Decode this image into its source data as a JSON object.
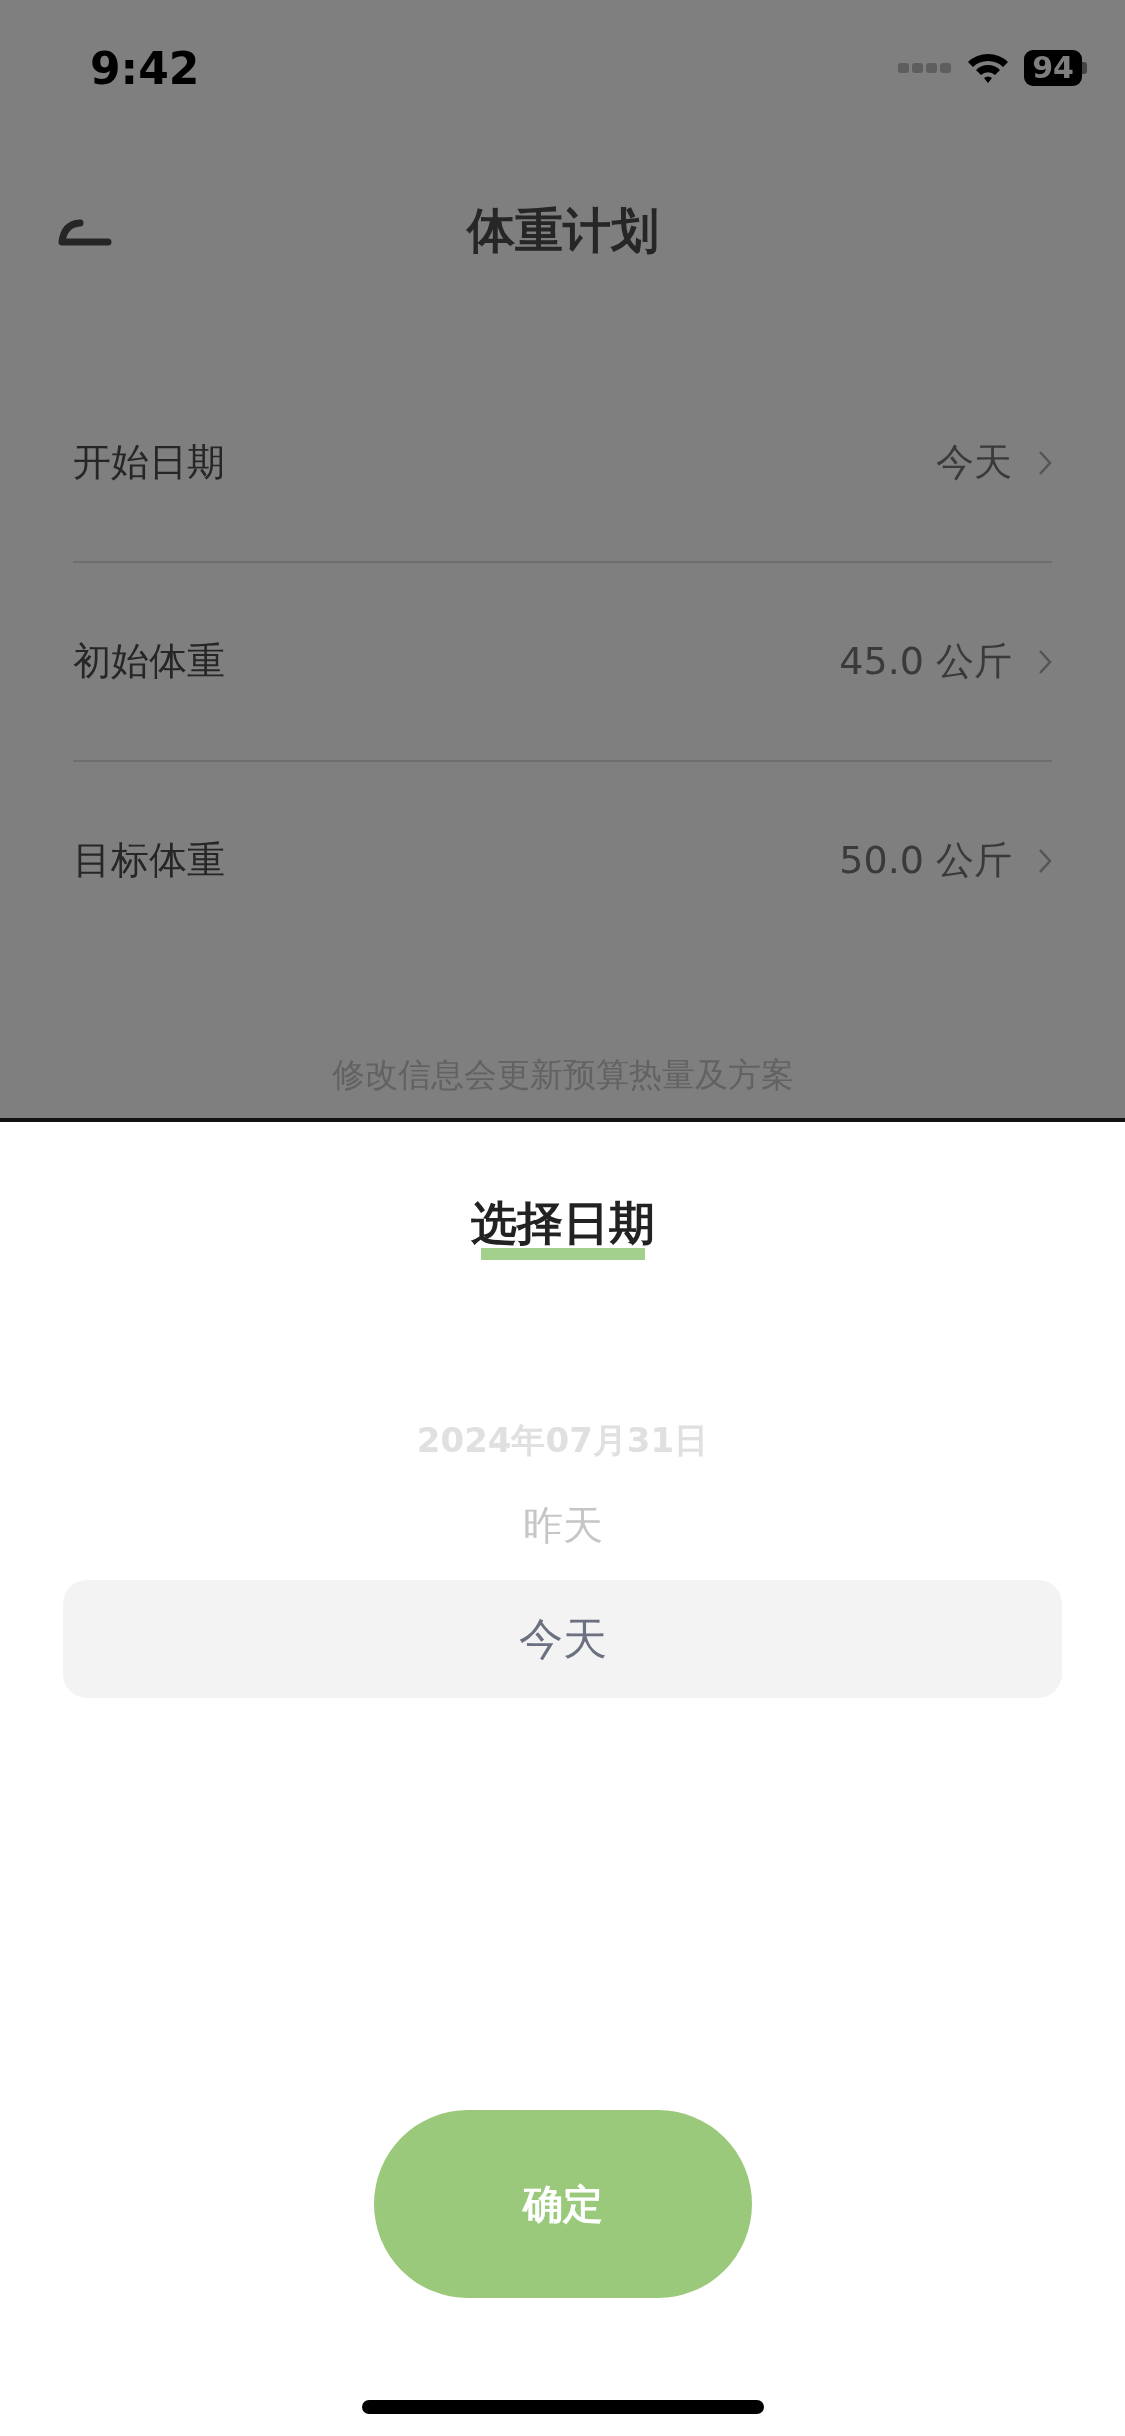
{
  "status_bar": {
    "time": "9:42",
    "battery": "94"
  },
  "nav": {
    "title": "体重计划"
  },
  "rows": [
    {
      "label": "开始日期",
      "value": "今天"
    },
    {
      "label": "初始体重",
      "value": "45.0 公斤"
    },
    {
      "label": "目标体重",
      "value": "50.0 公斤"
    }
  ],
  "note": "修改信息会更新预算热量及方案",
  "sheet": {
    "title": "选择日期",
    "options": [
      {
        "label": "2024年07月31日",
        "selected": false
      },
      {
        "label": "昨天",
        "selected": false
      },
      {
        "label": "今天",
        "selected": true
      }
    ],
    "confirm": "确定"
  }
}
